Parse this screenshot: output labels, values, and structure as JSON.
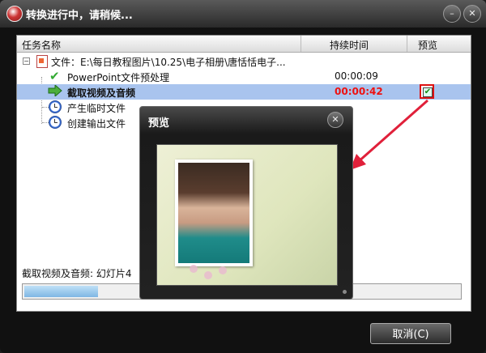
{
  "window": {
    "title": "转换进行中，请稍候...",
    "minimize_glyph": "–",
    "close_glyph": "✕"
  },
  "columns": {
    "task": "任务名称",
    "duration": "持续时间",
    "preview": "预览"
  },
  "rows": [
    {
      "label": "文件：E:\\每日教程图片\\10.25\\电子相册\\唐恬恬电子...",
      "time": "",
      "icon": "powerpoint-file-icon"
    },
    {
      "label": "PowerPoint文件预处理",
      "time": "00:00:09",
      "icon": "check-icon"
    },
    {
      "label": "截取视频及音频",
      "time": "00:00:42",
      "icon": "arrow-right-icon",
      "selected": true,
      "preview_checked": true
    },
    {
      "label": "产生临时文件",
      "time": "",
      "icon": "alarm-clock-icon"
    },
    {
      "label": "创建输出文件",
      "time": "",
      "icon": "alarm-clock-icon"
    }
  ],
  "status_text": "截取视频及音频: 幻灯片4",
  "progress_percent": 17,
  "cancel_label": "取消(C)",
  "preview_window": {
    "title": "预览",
    "close_glyph": "✕"
  },
  "colors": {
    "selected_row": "#a9c4ee",
    "time_active": "#e11111",
    "annotation_red": "#e0203a"
  }
}
